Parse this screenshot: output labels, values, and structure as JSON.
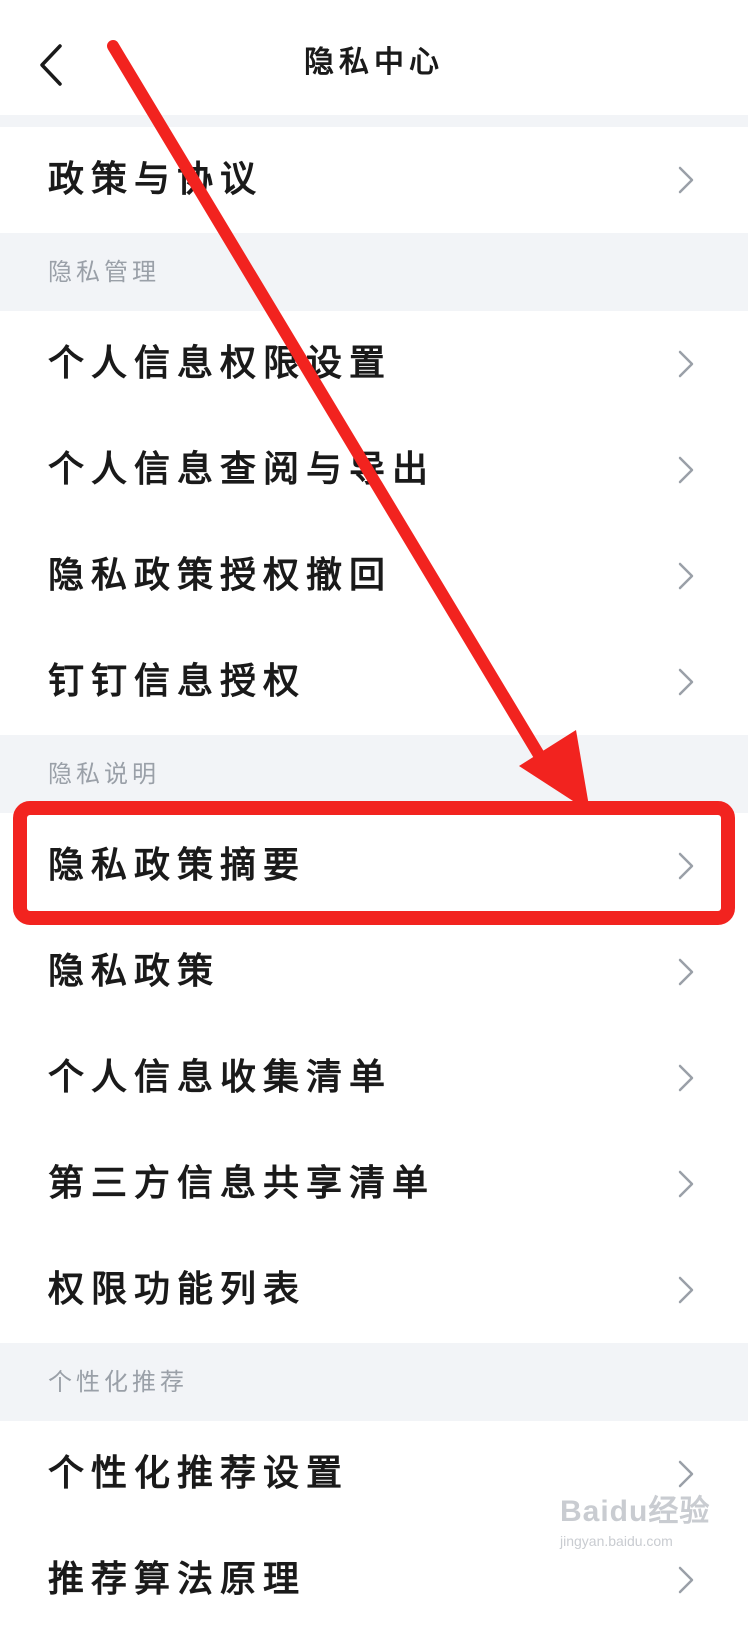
{
  "header": {
    "title": "隐私中心",
    "back_icon": "chevron-left-icon"
  },
  "rows": {
    "policy_agreement": "政策与协议",
    "permission_settings": "个人信息权限设置",
    "view_export": "个人信息查阅与导出",
    "revoke_authorization": "隐私政策授权撤回",
    "dingtalk_authorization": "钉钉信息授权",
    "policy_summary": "隐私政策摘要",
    "privacy_policy": "隐私政策",
    "collection_list": "个人信息收集清单",
    "third_party_list": "第三方信息共享清单",
    "permission_list": "权限功能列表",
    "recommend_settings": "个性化推荐设置",
    "algorithm_principle": "推荐算法原理"
  },
  "sections": {
    "privacy_management": "隐私管理",
    "privacy_description": "隐私说明",
    "personalized_recommendation": "个性化推荐"
  },
  "annotation": {
    "color": "#f2231f",
    "highlighted_row": "隐私政策摘要"
  },
  "watermark": {
    "logo": "Baidu经验",
    "url": "jingyan.baidu.com"
  },
  "colors": {
    "background": "#f2f4f7",
    "row": "#ffffff",
    "section_text": "#9aa0a8"
  }
}
